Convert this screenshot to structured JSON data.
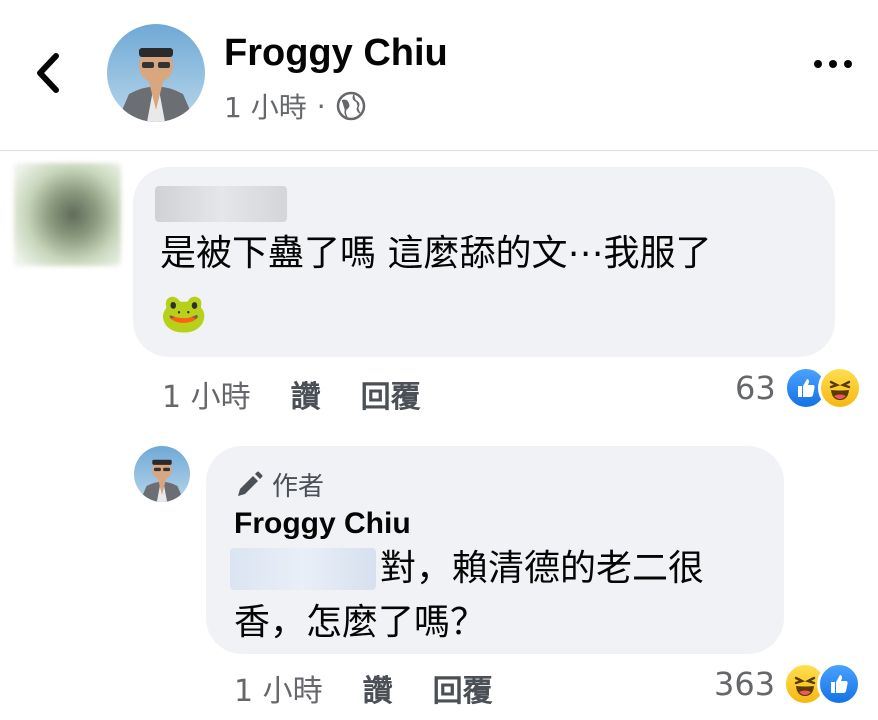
{
  "header": {
    "back_icon": "chevron-left-icon",
    "title": "Froggy Chiu",
    "time": "1 小時",
    "separator": "·",
    "privacy_icon": "globe-icon",
    "more_icon": "more-horizontal-icon"
  },
  "comment": {
    "text": "是被下蠱了嗎 這麼舔的文⋯我服了",
    "emoji": "🐸",
    "time": "1 小時",
    "like_label": "讚",
    "reply_label": "回覆",
    "reaction_count": "63",
    "reactions": [
      "like-icon",
      "haha-icon"
    ]
  },
  "reply": {
    "author_badge": "作者",
    "author_badge_icon": "pencil-icon",
    "name": "Froggy Chiu",
    "text_line1": "對，賴清德的老二很",
    "text_line2": "香，怎麼了嗎？",
    "time": "1 小時",
    "like_label": "讚",
    "reply_label": "回覆",
    "reaction_count": "363",
    "reactions": [
      "haha-icon",
      "like-icon"
    ]
  },
  "colors": {
    "bubble": "#f0f2f5",
    "secondary_text": "#65676b",
    "like_blue": "#1877f2",
    "haha_yellow": "#f7c52a"
  }
}
